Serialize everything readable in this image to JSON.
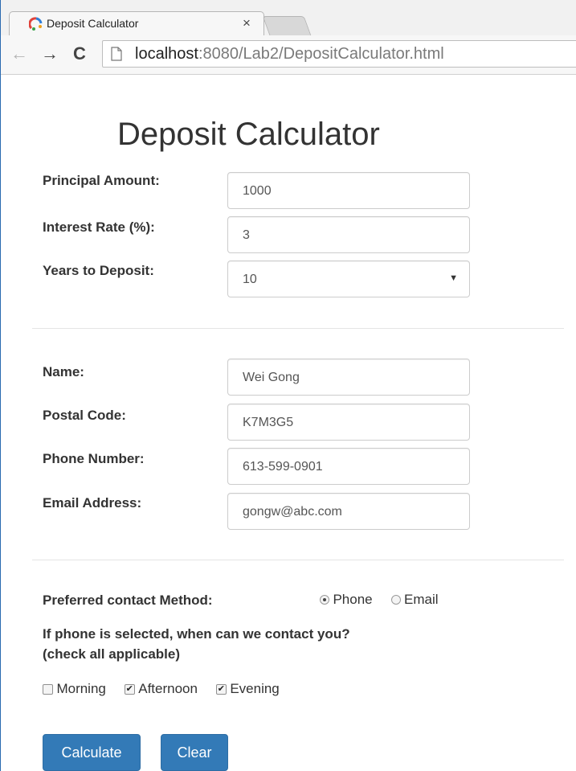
{
  "browser": {
    "tab_title": "Deposit Calculator",
    "tab_close": "×",
    "url_host": "localhost",
    "url_path": ":8080/Lab2/DepositCalculator.html",
    "nav_back": "←",
    "nav_forward": "→",
    "nav_reload": "C"
  },
  "page": {
    "title": "Deposit Calculator"
  },
  "deposit": {
    "principal_label": "Principal Amount:",
    "principal_value": "1000",
    "rate_label": "Interest Rate (%):",
    "rate_value": "3",
    "years_label": "Years to Deposit:",
    "years_value": "10"
  },
  "contact": {
    "name_label": "Name:",
    "name_value": "Wei Gong",
    "postal_label": "Postal Code:",
    "postal_value": "K7M3G5",
    "phone_label": "Phone Number:",
    "phone_value": "613-599-0901",
    "email_label": "Email Address:",
    "email_value": "gongw@abc.com"
  },
  "preferences": {
    "method_label": "Preferred contact Method:",
    "method_phone": "Phone",
    "method_email": "Email",
    "method_selected": "Phone",
    "question_line1": "If phone is selected, when can we contact you?",
    "question_line2": "(check all applicable)",
    "times": [
      {
        "label": "Morning",
        "checked": false
      },
      {
        "label": "Afternoon",
        "checked": true
      },
      {
        "label": "Evening",
        "checked": true
      }
    ]
  },
  "buttons": {
    "calculate": "Calculate",
    "clear": "Clear"
  },
  "colors": {
    "primary": "#337ab7",
    "frame": "#2a6ab0"
  }
}
